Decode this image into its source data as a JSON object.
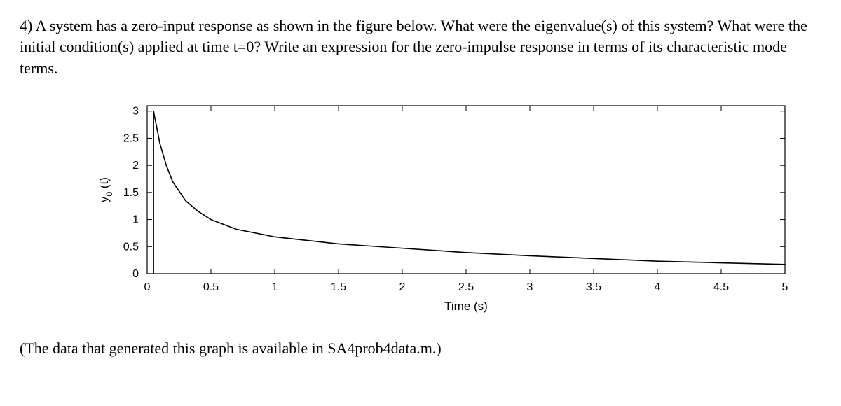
{
  "question": {
    "prefix": "4)  ",
    "text": "A system has a zero-input response as shown in the figure below.  What were the eigenvalue(s) of this system?  What were the initial condition(s) applied at time t=0? Write an expression for the zero-impulse response in terms of its characteristic mode terms."
  },
  "footnote": "(The data that generated this graph is available in SA4prob4data.m.)",
  "chart_data": {
    "type": "line",
    "title": "",
    "xlabel": "Time (s)",
    "ylabel": "y₀ (t)",
    "xlim": [
      0,
      5
    ],
    "ylim": [
      0,
      3.1
    ],
    "xticks": [
      0,
      0.5,
      1,
      1.5,
      2,
      2.5,
      3,
      3.5,
      4,
      4.5,
      5
    ],
    "yticks": [
      0,
      0.5,
      1,
      1.5,
      2,
      2.5,
      3
    ],
    "x_start": 0.05,
    "series": [
      {
        "name": "y0(t)",
        "x": [
          0,
          0.05,
          0.1,
          0.15,
          0.2,
          0.3,
          0.4,
          0.5,
          0.7,
          1.0,
          1.5,
          2.0,
          2.5,
          3.0,
          3.5,
          4.0,
          4.5,
          5.0
        ],
        "y": [
          0,
          3.0,
          2.4,
          2.0,
          1.7,
          1.35,
          1.15,
          1.0,
          0.82,
          0.68,
          0.55,
          0.47,
          0.39,
          0.33,
          0.28,
          0.23,
          0.2,
          0.17
        ]
      }
    ]
  }
}
